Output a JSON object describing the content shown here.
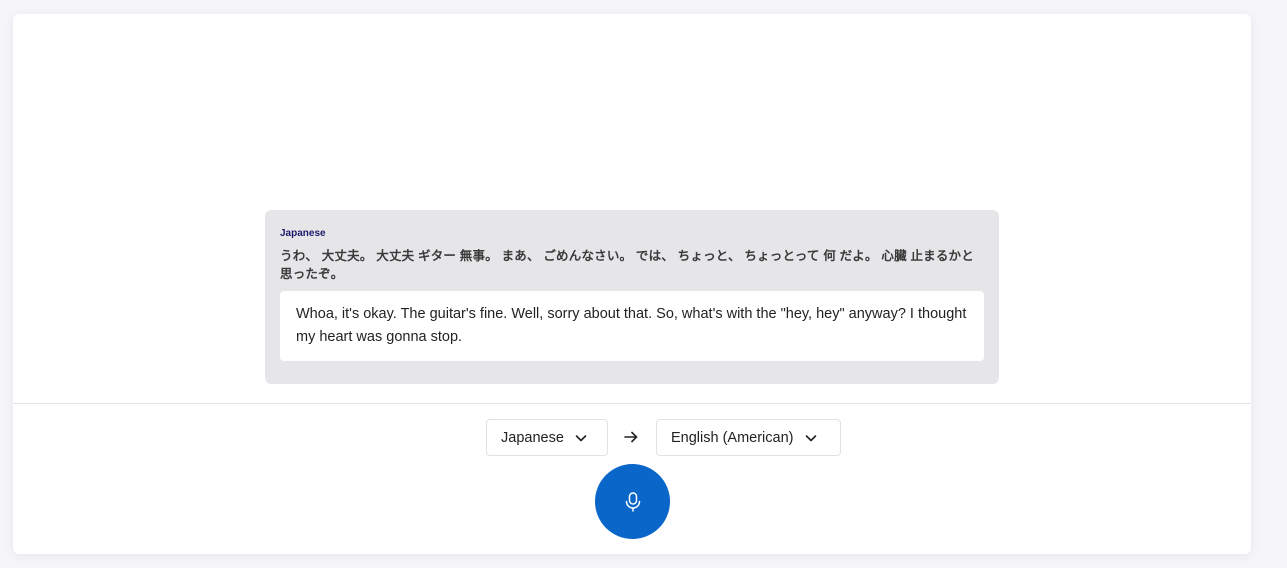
{
  "transcript": {
    "source_language": "Japanese",
    "source_text": "うわ、 大丈夫。 大丈夫 ギター 無事。 まあ、 ごめんなさい。 では、 ちょっと、 ちょっとって 何 だよ。 心臓 止まるかと 思ったぞ。",
    "translated_text": "Whoa, it's okay. The guitar's fine. Well, sorry about that. So, what's with the \"hey, hey\" anyway? I thought my heart was gonna stop."
  },
  "controls": {
    "source_language_label": "Japanese",
    "target_language_label": "English (American)",
    "source_dropdown_icon": "chevron-down-icon",
    "target_dropdown_icon": "chevron-down-icon",
    "swap_icon": "arrow-right-icon",
    "mic_icon": "microphone-icon"
  },
  "colors": {
    "accent": "#0a66c9",
    "bubble_background": "#e6e5e8",
    "source_language_label": "#1d1a6b"
  }
}
